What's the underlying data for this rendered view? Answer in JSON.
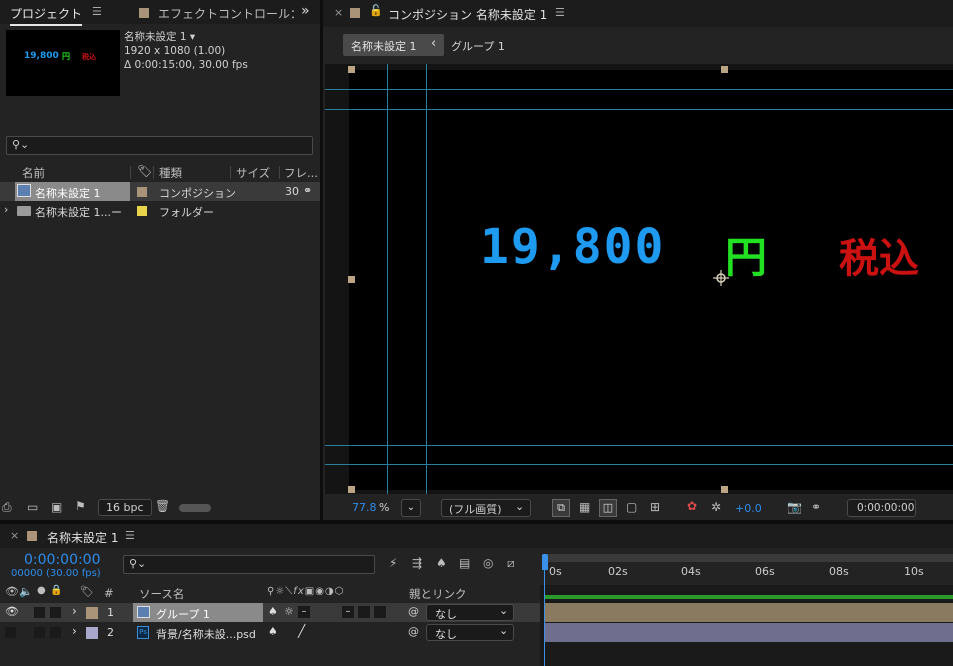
{
  "project_panel": {
    "tab_label": "プロジェクト",
    "effect_tab_label": "エフェクトコントロール：",
    "comp_name": "名称未設定 1 ▾",
    "comp_size": "1920 x 1080 (1.00)",
    "comp_duration": "Δ 0:00:15:00, 30.00 fps",
    "thumb_price": "19,800",
    "thumb_yen": "円",
    "thumb_tax": "税込",
    "search_placeholder": "",
    "columns": {
      "name": "名前",
      "type": "種類",
      "size": "サイズ",
      "frame": "フレ..."
    },
    "rows": [
      {
        "name": "名称未設定 1",
        "type": "コンポジション",
        "size": "30"
      },
      {
        "name": "名称未設定 1...ー",
        "type": "フォルダー",
        "size": ""
      }
    ],
    "bpc_label": "16 bpc"
  },
  "comp_panel": {
    "tab_label": "コンポジション 名称未設定 1",
    "breadcrumb_1": "名称未設定 1",
    "breadcrumb_2": "グループ 1",
    "price_text": "19,800",
    "yen_text": "円",
    "tax_text": "税込",
    "zoom_value": "77.8",
    "zoom_unit": "%",
    "quality_label": "(フル画質)",
    "exposure_value": "+0.0",
    "timecode": "0:00:00:00"
  },
  "timeline_panel": {
    "tab_label": "名称未設定 1",
    "timecode": "0:00:00:00",
    "frame_info": "00000 (30.00 fps)",
    "search_placeholder": "",
    "col_num": "#",
    "col_source": "ソース名",
    "col_parent": "親とリンク",
    "ruler_ticks": [
      "0s",
      "02s",
      "04s",
      "06s",
      "08s",
      "10s"
    ],
    "layers": [
      {
        "num": "1",
        "name": "グループ 1",
        "parent": "なし"
      },
      {
        "num": "2",
        "name": "背景/名称未設...psd",
        "parent": "なし"
      }
    ]
  },
  "colors": {
    "accent_blue": "#2d8ceb",
    "price_blue": "#1e9bf0",
    "yen_green": "#22e022",
    "tax_red": "#cc1111",
    "label_tan": "#a99479",
    "label_lavender": "#a9a8cc",
    "folder_yellow": "#e8d34a",
    "guide_cyan": "#2a7f9a"
  }
}
